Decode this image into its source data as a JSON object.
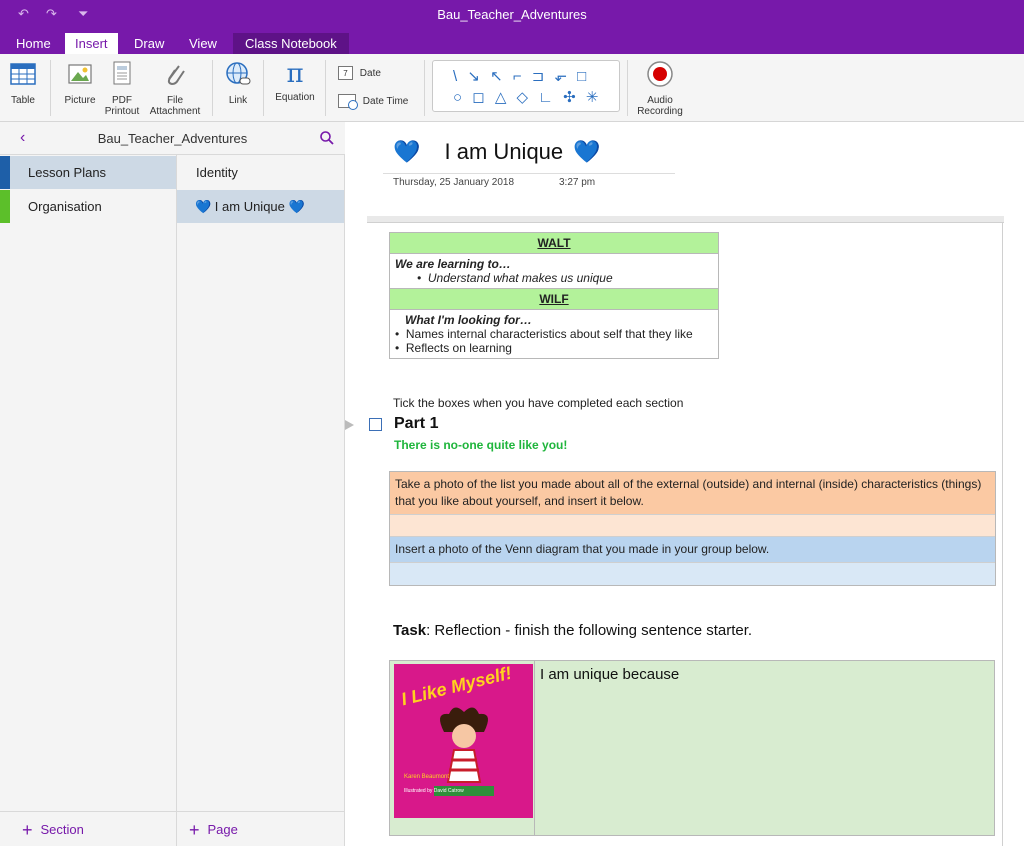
{
  "window": {
    "title": "Bau_Teacher_Adventures"
  },
  "tabs": [
    {
      "label": "Home"
    },
    {
      "label": "Insert"
    },
    {
      "label": "Draw"
    },
    {
      "label": "View"
    },
    {
      "label": "Class Notebook"
    }
  ],
  "ribbon": {
    "table": "Table",
    "picture": "Picture",
    "pdf_line1": "PDF",
    "pdf_line2": "Printout",
    "file_line1": "File",
    "file_line2": "Attachment",
    "link": "Link",
    "equation": "Equation",
    "date": "Date",
    "date_time": "Date  Time",
    "audio_line1": "Audio",
    "audio_line2": "Recording",
    "shapes_row1": "\\ ↘ ↖ ⌐ ⊐ ⬐ □",
    "shapes_row2": "○ ◻ △ ◇ ∟ ✣ ✳"
  },
  "notebook": {
    "name": "Bau_Teacher_Adventures"
  },
  "sections": [
    {
      "label": "Lesson Plans",
      "color": "#1e5fa8"
    },
    {
      "label": "Organisation",
      "color": "#5cbf2a"
    }
  ],
  "pages": [
    {
      "label": "Identity"
    },
    {
      "label": "💙 I am Unique 💙"
    }
  ],
  "footer": {
    "add_section": "Section",
    "add_page": "Page"
  },
  "page": {
    "title": "I am Unique",
    "date": "Thursday, 25 January 2018",
    "time": "3:27 pm",
    "walt_header": "WALT",
    "walt_intro": "We are learning to…",
    "walt_item": "Understand what makes us unique",
    "wilf_header": "WILF",
    "wilf_intro": "What I'm looking for…",
    "wilf_items": [
      "Names internal characteristics about self that they like",
      "Reflects on learning"
    ],
    "tick_instruction": "Tick the boxes when you have completed each section",
    "part1": "Part 1",
    "part1_sub": "There is no-one quite like you!",
    "photo_instruction": "Take a photo of the list you made about all of the external (outside) and internal (inside) characteristics (things) that you like about yourself, and insert it below.",
    "venn_instruction": "Insert a photo of the Venn diagram that you made in your group below.",
    "task_label": "Task",
    "task_text": ": Reflection - finish the following sentence starter.",
    "sentence": "I am unique because",
    "book_title": "I Like Myself!",
    "book_author": "Karen Beaumont",
    "book_illustrator": "Illustrated by David Catrow"
  }
}
